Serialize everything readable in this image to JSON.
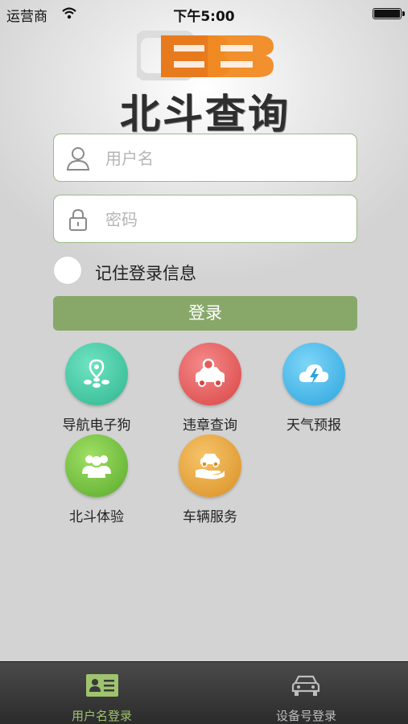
{
  "status_bar": {
    "carrier": "运营商",
    "time": "下午5:00"
  },
  "logo": {
    "title": "北斗查询",
    "mark_color": "#e87a1e"
  },
  "login_form": {
    "username_placeholder": "用户名",
    "password_placeholder": "密码",
    "remember_label": "记住登录信息",
    "login_button": "登录"
  },
  "services": [
    {
      "label": "导航电子狗",
      "icon": "navigation-pin-icon",
      "color": "#3ec9a4"
    },
    {
      "label": "违章查询",
      "icon": "car-search-icon",
      "color": "#e45c5c"
    },
    {
      "label": "天气预报",
      "icon": "weather-icon",
      "color": "#3ab6ea"
    },
    {
      "label": "北斗体验",
      "icon": "users-icon",
      "color": "#6fbf3c"
    },
    {
      "label": "车辆服务",
      "icon": "car-hand-icon",
      "color": "#e6a53b"
    }
  ],
  "tab_bar": {
    "tabs": [
      {
        "label": "用户名登录",
        "icon": "id-card-icon",
        "active": true
      },
      {
        "label": "设备号登录",
        "icon": "car-icon",
        "active": false
      }
    ],
    "active_color": "#9fc36e",
    "inactive_color": "#bdbdbd"
  }
}
